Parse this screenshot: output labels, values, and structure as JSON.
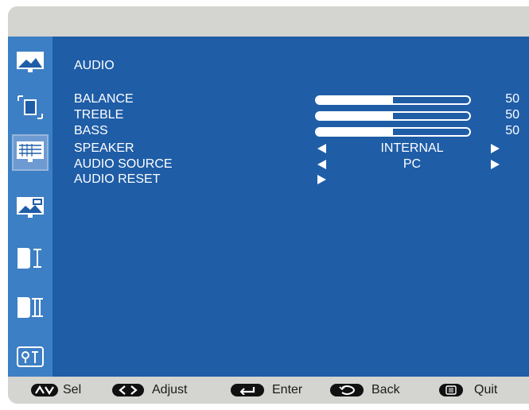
{
  "menu": {
    "title": "AUDIO",
    "rows": [
      {
        "label": "BALANCE",
        "type": "slider",
        "value": "50",
        "level": 0.5
      },
      {
        "label": "TREBLE",
        "type": "slider",
        "value": "50",
        "level": 0.5
      },
      {
        "label": "BASS",
        "type": "slider",
        "value": "50",
        "level": 0.5
      },
      {
        "label": "SPEAKER",
        "type": "select",
        "option": "INTERNAL"
      },
      {
        "label": "AUDIO SOURCE",
        "type": "select",
        "option": "PC"
      },
      {
        "label": "AUDIO RESET",
        "type": "action"
      }
    ]
  },
  "sidebar": {
    "items": [
      {
        "icon": "picture-icon",
        "selected": false
      },
      {
        "icon": "screen-adjust-icon",
        "selected": false
      },
      {
        "icon": "audio-icon",
        "selected": true
      },
      {
        "icon": "pip-icon",
        "selected": false
      },
      {
        "icon": "config-one-icon",
        "selected": false
      },
      {
        "icon": "config-two-icon",
        "selected": false
      },
      {
        "icon": "options-icon",
        "selected": false
      }
    ]
  },
  "footer": {
    "sel": "Sel",
    "adjust": "Adjust",
    "enter": "Enter",
    "back": "Back",
    "quit": "Quit"
  },
  "colors": {
    "main_bg": "#1f5da7",
    "sidebar_bg": "#3d7fc4",
    "frame_bg": "#d4d4d0"
  }
}
